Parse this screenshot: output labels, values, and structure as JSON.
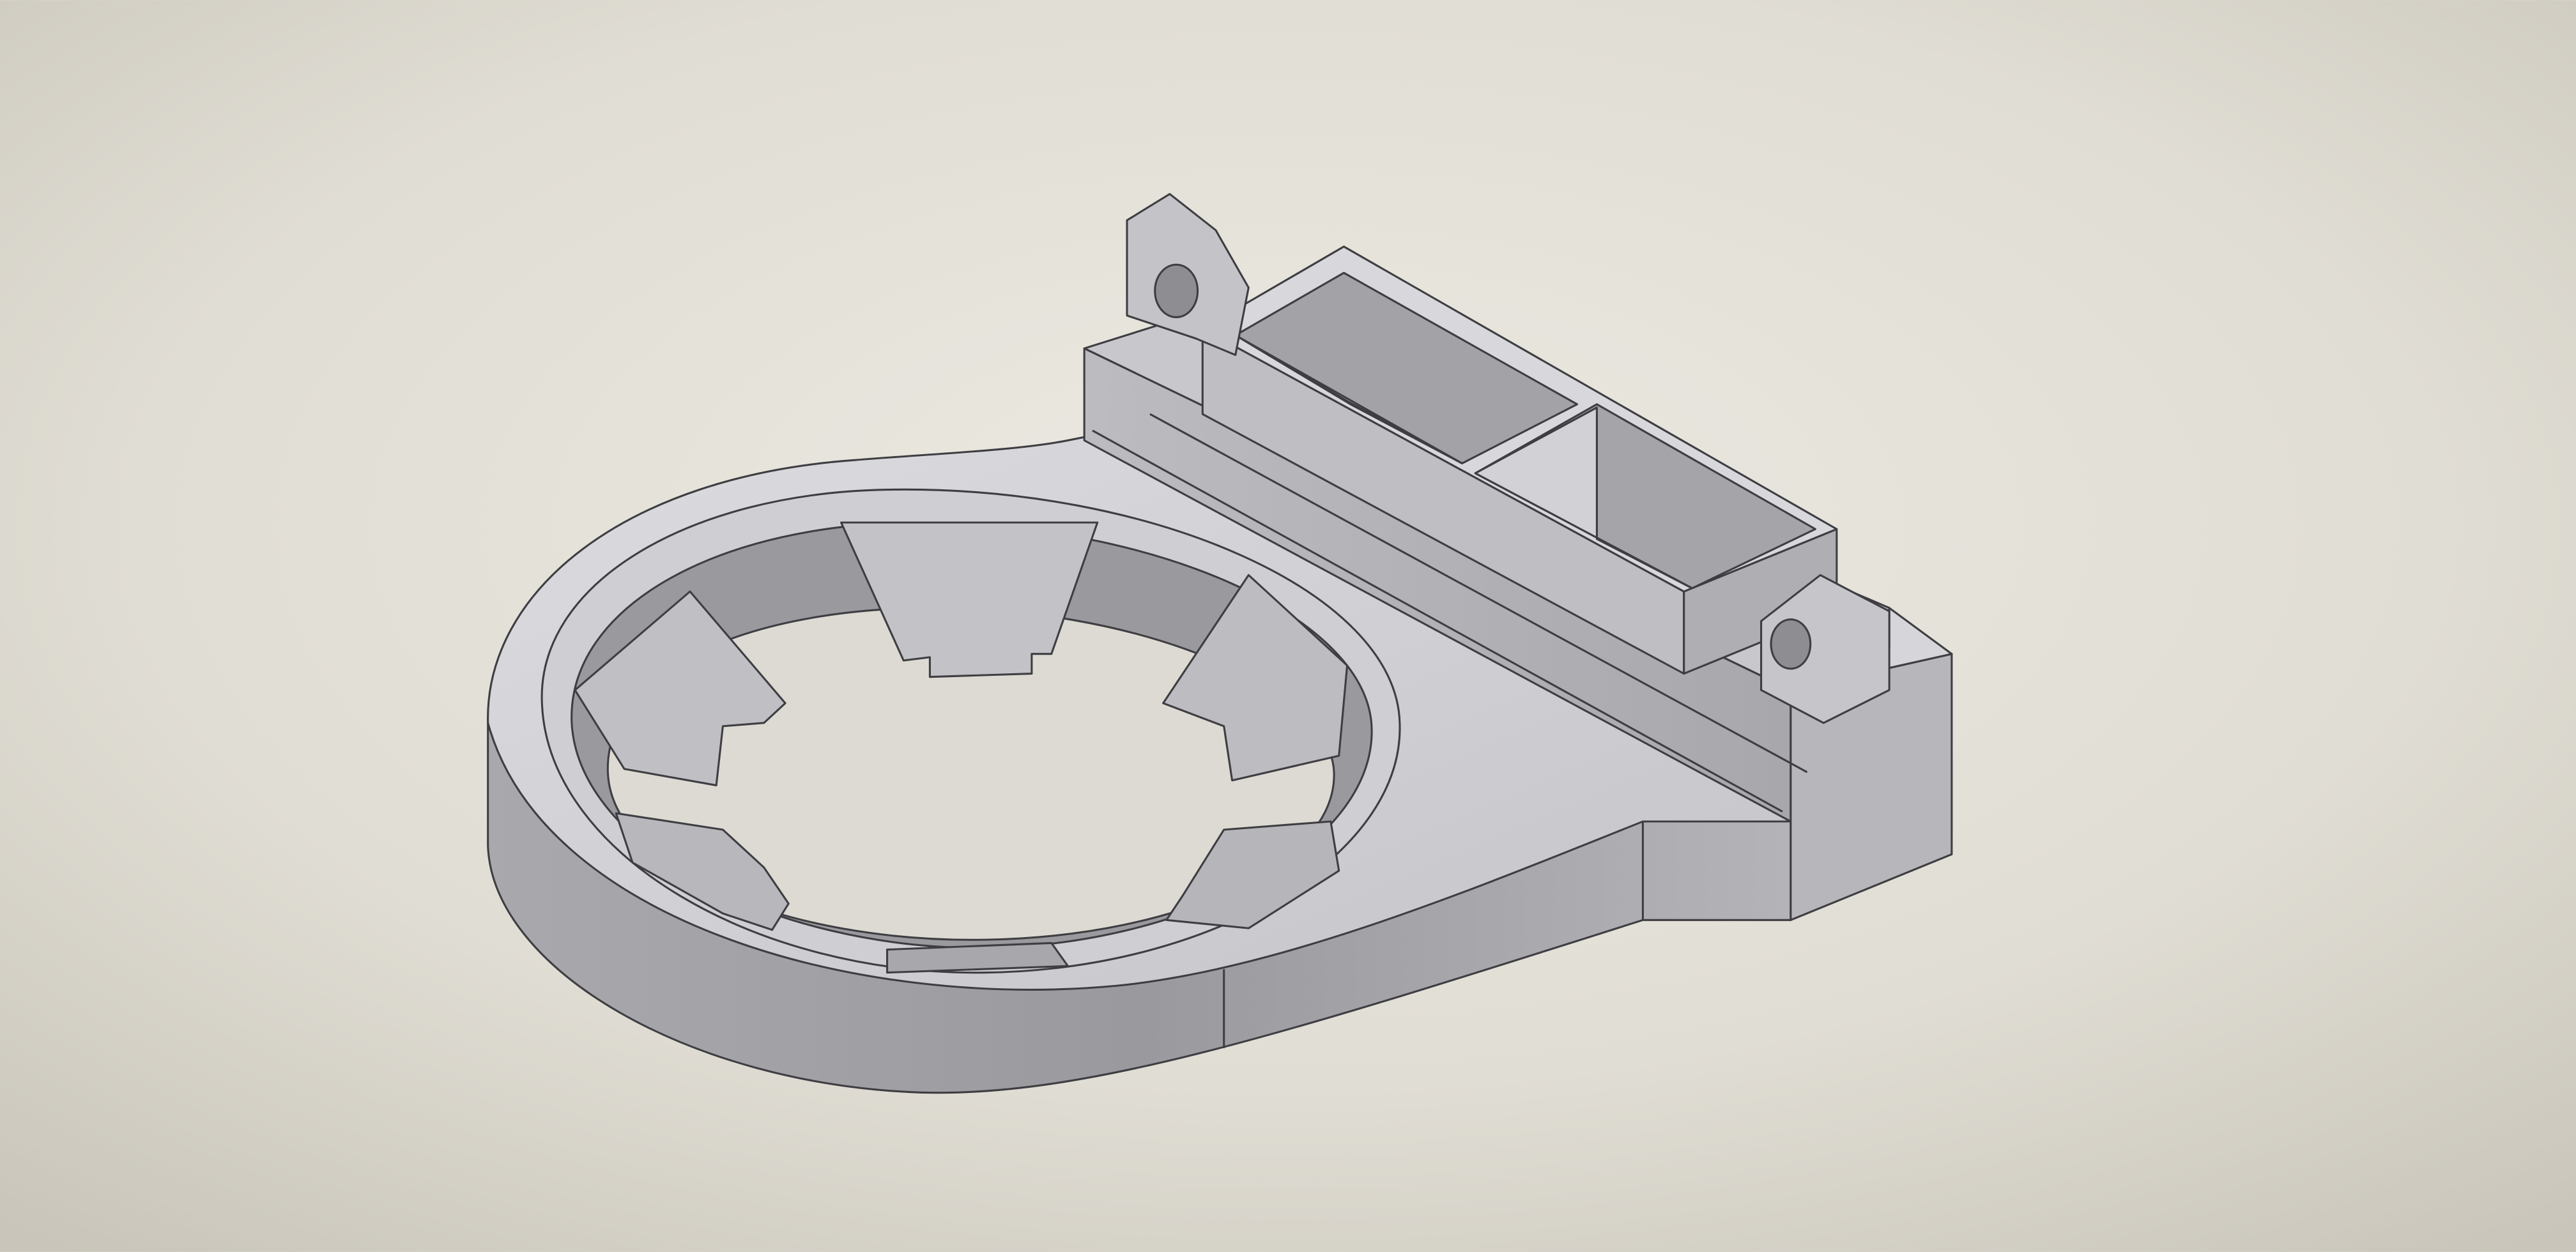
{
  "scene": {
    "subject": "cad-part-render",
    "colors": {
      "backdrop_light": "#ebe9e1",
      "backdrop_edge": "#c9c5ba",
      "part_top": "#d4d4d6",
      "part_light": "#e6e6ea",
      "part_mid": "#b9b9bc",
      "part_dark": "#9c9c9f",
      "edge_line": "#3e3e42"
    }
  }
}
